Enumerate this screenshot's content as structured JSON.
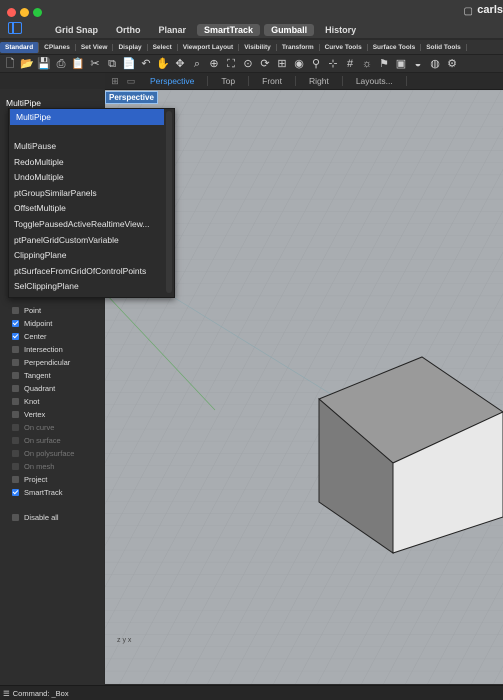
{
  "window": {
    "title": "carls"
  },
  "status_toggles": [
    {
      "label": "Grid Snap",
      "on": false
    },
    {
      "label": "Ortho",
      "on": false
    },
    {
      "label": "Planar",
      "on": false
    },
    {
      "label": "SmartTrack",
      "on": true
    },
    {
      "label": "Gumball",
      "on": true
    },
    {
      "label": "History",
      "on": false
    }
  ],
  "toolbar_tabs": [
    "Standard",
    "CPlanes",
    "Set View",
    "Display",
    "Select",
    "Viewport Layout",
    "Visibility",
    "Transform",
    "Curve Tools",
    "Surface Tools",
    "Solid Tools"
  ],
  "toolbar_icons": [
    "new-file-icon",
    "open-folder-icon",
    "save-icon",
    "print-icon",
    "clipboard-icon",
    "cut-icon",
    "copy-icon",
    "paste-icon",
    "undo-icon",
    "pan-hand-icon",
    "move-icon",
    "zoom-icon",
    "zoom-window-icon",
    "zoom-extents-icon",
    "zoom-selected-icon",
    "rotate-view-icon",
    "four-views-icon",
    "camera-icon",
    "lock-icon",
    "snap-icon",
    "grid-icon",
    "light-bulb-icon",
    "pin-icon",
    "lock-layer-icon",
    "render-icon",
    "color-wheel-icon",
    "settings-icon"
  ],
  "view_tabs": {
    "active": "Perspective",
    "items": [
      "Top",
      "Front",
      "Right",
      "Layouts..."
    ]
  },
  "viewport": {
    "label": "Perspective",
    "axes_label": "z y x"
  },
  "command": {
    "input_value": "MultiPipe",
    "prompt": "Command: _Box"
  },
  "autocomplete": {
    "selected": "MultiPipe",
    "items": [
      "MultiPause",
      "RedoMultiple",
      "UndoMultiple",
      "ptGroupSimilarPanels",
      "OffsetMultiple",
      "TogglePausedActiveRealtimeView...",
      "ptPanelGridCustomVariable",
      "ClippingPlane",
      "ptSurfaceFromGridOfControlPoints",
      "SelClippingPlane"
    ]
  },
  "osnaps": [
    {
      "label": "Point",
      "checked": false,
      "disabled": false
    },
    {
      "label": "Midpoint",
      "checked": true,
      "disabled": false
    },
    {
      "label": "Center",
      "checked": true,
      "disabled": false
    },
    {
      "label": "Intersection",
      "checked": false,
      "disabled": false
    },
    {
      "label": "Perpendicular",
      "checked": false,
      "disabled": false
    },
    {
      "label": "Tangent",
      "checked": false,
      "disabled": false
    },
    {
      "label": "Quadrant",
      "checked": false,
      "disabled": false
    },
    {
      "label": "Knot",
      "checked": false,
      "disabled": false
    },
    {
      "label": "Vertex",
      "checked": false,
      "disabled": false
    },
    {
      "label": "On curve",
      "checked": false,
      "disabled": true
    },
    {
      "label": "On surface",
      "checked": false,
      "disabled": true
    },
    {
      "label": "On polysurface",
      "checked": false,
      "disabled": true
    },
    {
      "label": "On mesh",
      "checked": false,
      "disabled": true
    },
    {
      "label": "Project",
      "checked": false,
      "disabled": false
    },
    {
      "label": "SmartTrack",
      "checked": true,
      "disabled": false
    },
    {
      "label": "Disable all",
      "checked": false,
      "disabled": false
    }
  ],
  "colors": {
    "accent": "#2f63c6",
    "viewport_bg": "#a9adb1",
    "active_tab": "#4aa3ff"
  }
}
